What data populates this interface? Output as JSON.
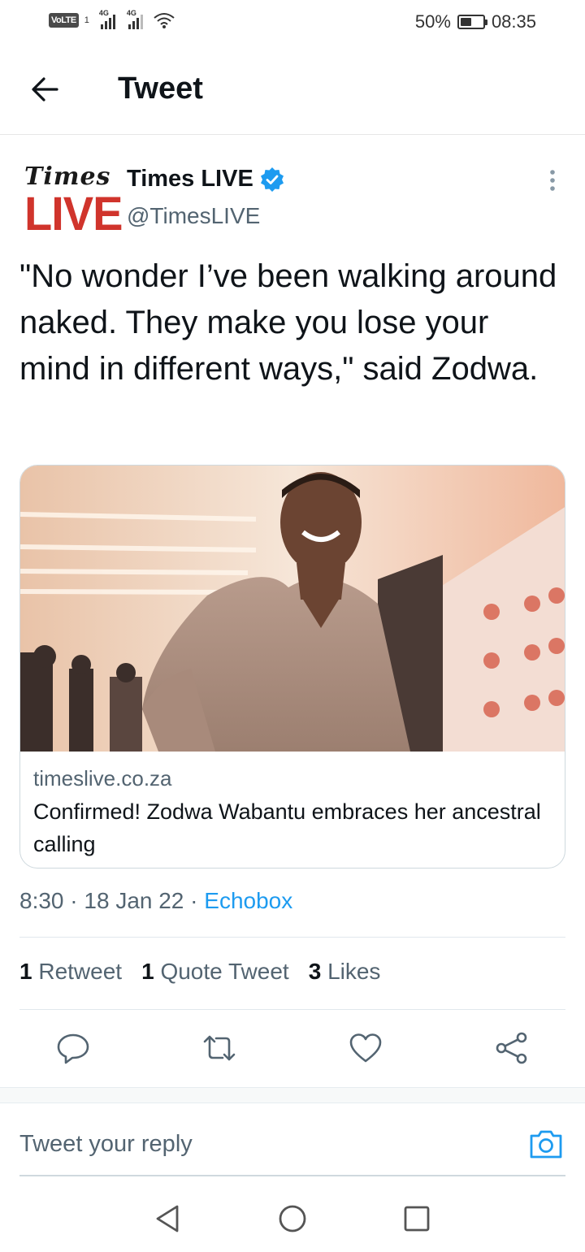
{
  "status_bar": {
    "volte": "VoLTE",
    "sim": "1",
    "network_1": "4G",
    "network_2": "4G",
    "battery_percent": "50%",
    "battery_level": 0.5,
    "time": "08:35"
  },
  "header": {
    "title": "Tweet",
    "back_icon": "arrow-left-icon"
  },
  "tweet": {
    "avatar_line1": "Times",
    "avatar_line2": "LIVE",
    "author_name": "Times LIVE",
    "author_handle": "@TimesLIVE",
    "text": "\"No wonder I’ve been walking around naked. They make you lose your mind in different ways,\" said Zodwa.",
    "card": {
      "domain": "timeslive.co.za",
      "title": "Confirmed! Zodwa Wabantu embraces her ancestral calling"
    },
    "time": "8:30",
    "date": "18 Jan 22",
    "source": "Echobox",
    "stats": {
      "retweets_count": "1",
      "retweets_label": "Retweet",
      "quotes_count": "1",
      "quotes_label": "Quote Tweet",
      "likes_count": "3",
      "likes_label": "Likes"
    }
  },
  "actions": [
    "reply-icon",
    "retweet-icon",
    "like-icon",
    "share-icon"
  ],
  "reply": {
    "placeholder": "Tweet your reply"
  },
  "colors": {
    "accent": "#1d9bf0",
    "brand_red": "#d0342c",
    "text_primary": "#0f1419",
    "text_secondary": "#536471"
  }
}
